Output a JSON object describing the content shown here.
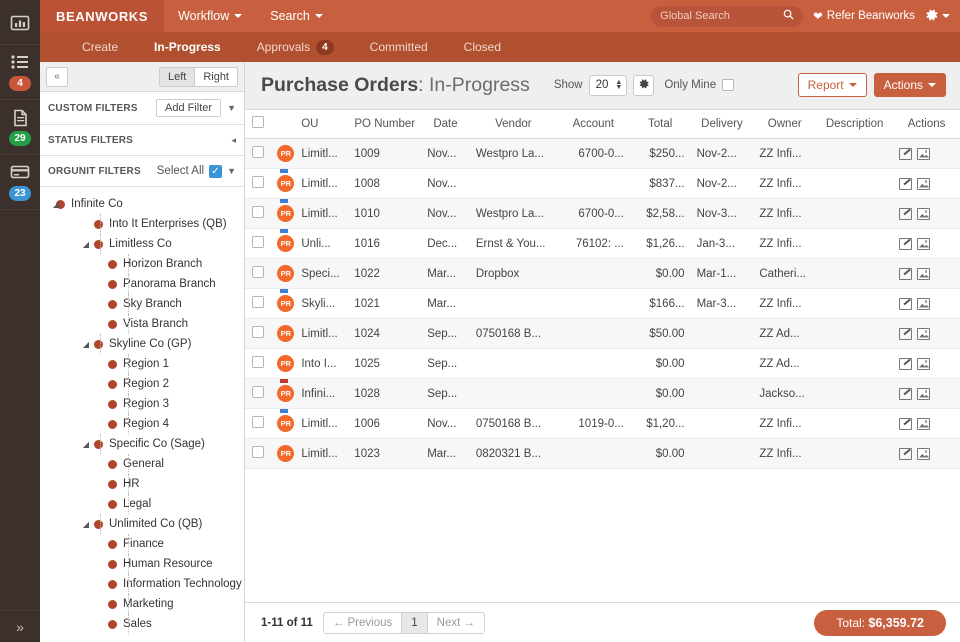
{
  "rail": {
    "items": [
      {
        "icon": "chart-bar-icon",
        "name": "rail-dashboard",
        "badge": null,
        "badge_color": null
      },
      {
        "icon": "list-icon",
        "name": "rail-workflow",
        "badge": "4",
        "badge_color": "#c9573c"
      },
      {
        "icon": "document-icon",
        "name": "rail-invoices",
        "badge": "29",
        "badge_color": "#24a148"
      },
      {
        "icon": "credit-card-icon",
        "name": "rail-payments",
        "badge": "23",
        "badge_color": "#3b95d4"
      }
    ],
    "expand_icon": "double-chevron-right-icon"
  },
  "topbar": {
    "brand": "BEANWORKS",
    "nav": [
      {
        "label": "Workflow",
        "has_caret": true
      },
      {
        "label": "Search",
        "has_caret": true
      }
    ],
    "search_placeholder": "Global Search",
    "search_icon": "search-icon",
    "refer_label": "Refer Beanworks",
    "refer_icon": "heart-icon",
    "gear_icon": "gear-icon"
  },
  "subnav": {
    "items": [
      {
        "label": "Create",
        "active": false,
        "badge": null
      },
      {
        "label": "In-Progress",
        "active": true,
        "badge": null
      },
      {
        "label": "Approvals",
        "active": false,
        "badge": "4"
      },
      {
        "label": "Committed",
        "active": false,
        "badge": null
      },
      {
        "label": "Closed",
        "active": false,
        "badge": null
      }
    ]
  },
  "filters": {
    "collapse_label": "«",
    "left_label": "Left",
    "right_label": "Right",
    "custom_filters_label": "CUSTOM FILTERS",
    "add_filter_label": "Add Filter",
    "status_filters_label": "STATUS FILTERS",
    "orgunit_filters_label": "ORGUNIT FILTERS",
    "select_all_label": "Select All",
    "tree": [
      {
        "label": "Infinite Co",
        "level": 0,
        "twisty": true
      },
      {
        "label": "Into It Enterprises (QB)",
        "level": 1,
        "twisty": false
      },
      {
        "label": "Limitless Co",
        "level": 1,
        "twisty": true
      },
      {
        "label": "Horizon Branch",
        "level": 2,
        "twisty": false
      },
      {
        "label": "Panorama Branch",
        "level": 2,
        "twisty": false
      },
      {
        "label": "Sky Branch",
        "level": 2,
        "twisty": false
      },
      {
        "label": "Vista Branch",
        "level": 2,
        "twisty": false
      },
      {
        "label": "Skyline Co (GP)",
        "level": 1,
        "twisty": true
      },
      {
        "label": "Region 1",
        "level": 2,
        "twisty": false
      },
      {
        "label": "Region 2",
        "level": 2,
        "twisty": false
      },
      {
        "label": "Region 3",
        "level": 2,
        "twisty": false
      },
      {
        "label": "Region 4",
        "level": 2,
        "twisty": false
      },
      {
        "label": "Specific Co (Sage)",
        "level": 1,
        "twisty": true
      },
      {
        "label": "General",
        "level": 2,
        "twisty": false
      },
      {
        "label": "HR",
        "level": 2,
        "twisty": false
      },
      {
        "label": "Legal",
        "level": 2,
        "twisty": false
      },
      {
        "label": "Unlimited Co (QB)",
        "level": 1,
        "twisty": true
      },
      {
        "label": "Finance",
        "level": 2,
        "twisty": false
      },
      {
        "label": "Human Resource",
        "level": 2,
        "twisty": false
      },
      {
        "label": "Information Technology",
        "level": 2,
        "twisty": false
      },
      {
        "label": "Marketing",
        "level": 2,
        "twisty": false
      },
      {
        "label": "Sales",
        "level": 2,
        "twisty": false
      }
    ]
  },
  "main": {
    "title_main": "Purchase Orders",
    "title_sep": ": ",
    "title_sub": "In-Progress",
    "show_label": "Show",
    "show_value": "20",
    "gear_icon": "gear-icon",
    "only_mine_label": "Only Mine",
    "report_label": "Report",
    "actions_label": "Actions"
  },
  "table": {
    "columns": [
      "OU",
      "PO Number",
      "Date",
      "Vendor",
      "Account",
      "Total",
      "Delivery",
      "Owner",
      "Description",
      "Actions"
    ],
    "avatar_initials": "PR",
    "rows": [
      {
        "flag": null,
        "ou": "Limitl...",
        "po": "1009",
        "date": "Nov...",
        "vendor": "Westpro La...",
        "account": "6700-0...",
        "total": "$250...",
        "delivery": "Nov-2...",
        "owner": "ZZ Infi...",
        "description": ""
      },
      {
        "flag": "blue",
        "ou": "Limitl...",
        "po": "1008",
        "date": "Nov...",
        "vendor": "",
        "account": "",
        "total": "$837...",
        "delivery": "Nov-2...",
        "owner": "ZZ Infi...",
        "description": ""
      },
      {
        "flag": "blue",
        "ou": "Limitl...",
        "po": "1010",
        "date": "Nov...",
        "vendor": "Westpro La...",
        "account": "6700-0...",
        "total": "$2,58...",
        "delivery": "Nov-3...",
        "owner": "ZZ Infi...",
        "description": ""
      },
      {
        "flag": "blue",
        "ou": "Unli...",
        "po": "1016",
        "date": "Dec...",
        "vendor": "Ernst & You...",
        "account": "76102: ...",
        "total": "$1,26...",
        "delivery": "Jan-3...",
        "owner": "ZZ Infi...",
        "description": ""
      },
      {
        "flag": null,
        "ou": "Speci...",
        "po": "1022",
        "date": "Mar...",
        "vendor": "Dropbox",
        "account": "",
        "total": "$0.00",
        "delivery": "Mar-1...",
        "owner": "Catheri...",
        "description": ""
      },
      {
        "flag": "blue",
        "ou": "Skyli...",
        "po": "1021",
        "date": "Mar...",
        "vendor": "",
        "account": "",
        "total": "$166...",
        "delivery": "Mar-3...",
        "owner": "ZZ Infi...",
        "description": ""
      },
      {
        "flag": null,
        "ou": "Limitl...",
        "po": "1024",
        "date": "Sep...",
        "vendor": "0750168 B...",
        "account": "",
        "total": "$50.00",
        "delivery": "",
        "owner": "ZZ Ad...",
        "description": ""
      },
      {
        "flag": null,
        "ou": "Into I...",
        "po": "1025",
        "date": "Sep...",
        "vendor": "",
        "account": "",
        "total": "$0.00",
        "delivery": "",
        "owner": "ZZ Ad...",
        "description": ""
      },
      {
        "flag": "red",
        "ou": "Infini...",
        "po": "1028",
        "date": "Sep...",
        "vendor": "",
        "account": "",
        "total": "$0.00",
        "delivery": "",
        "owner": "Jackso...",
        "description": ""
      },
      {
        "flag": "blue",
        "ou": "Limitl...",
        "po": "1006",
        "date": "Nov...",
        "vendor": "0750168 B...",
        "account": "1019-0...",
        "total": "$1,20...",
        "delivery": "",
        "owner": "ZZ Infi...",
        "description": ""
      },
      {
        "flag": null,
        "ou": "Limitl...",
        "po": "1023",
        "date": "Mar...",
        "vendor": "0820321 B...",
        "account": "",
        "total": "$0.00",
        "delivery": "",
        "owner": "ZZ Infi...",
        "description": ""
      }
    ],
    "action_icons": [
      "edit-pencil-icon",
      "image-icon"
    ]
  },
  "footer": {
    "range_label": "1-11 of 11",
    "previous_label": "← Previous",
    "page_number": "1",
    "next_label": "Next →",
    "total_label": "Total:",
    "total_value": "$6,359.72"
  },
  "colors": {
    "brand": "#bb5135",
    "topbar": "#c8603f",
    "subnav": "#b0502f",
    "accent": "#c8603f",
    "rail": "#3b302c",
    "avatar": "#f4682a"
  }
}
